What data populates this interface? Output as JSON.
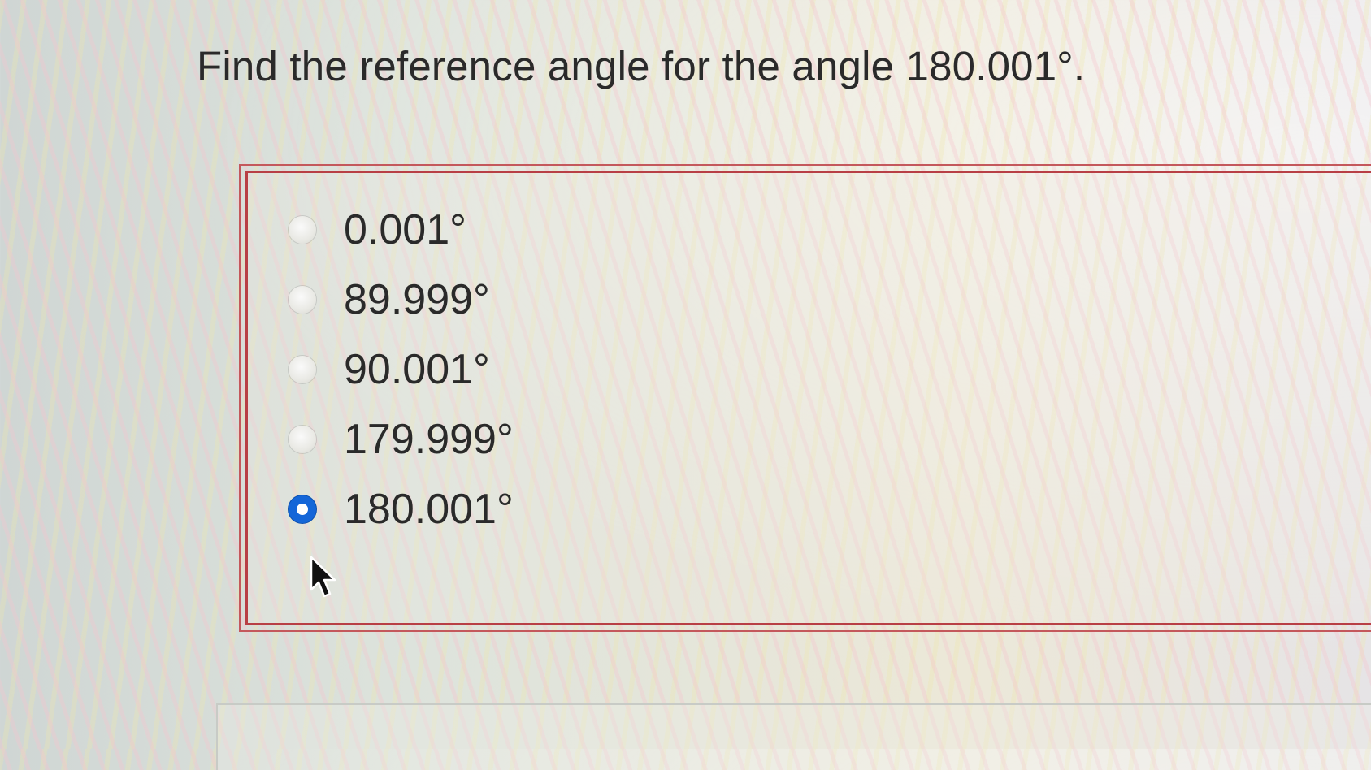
{
  "question": {
    "text": "Find the reference angle for the angle 180.001°."
  },
  "options": [
    {
      "label": "0.001°",
      "selected": false
    },
    {
      "label": "89.999°",
      "selected": false
    },
    {
      "label": "90.001°",
      "selected": false
    },
    {
      "label": "179.999°",
      "selected": false
    },
    {
      "label": "180.001°",
      "selected": true
    }
  ],
  "colors": {
    "box_border": "#b83f45",
    "radio_selected": "#1466d8",
    "text": "#2a2a2a"
  },
  "icons": {
    "cursor": "mouse-pointer-icon"
  }
}
